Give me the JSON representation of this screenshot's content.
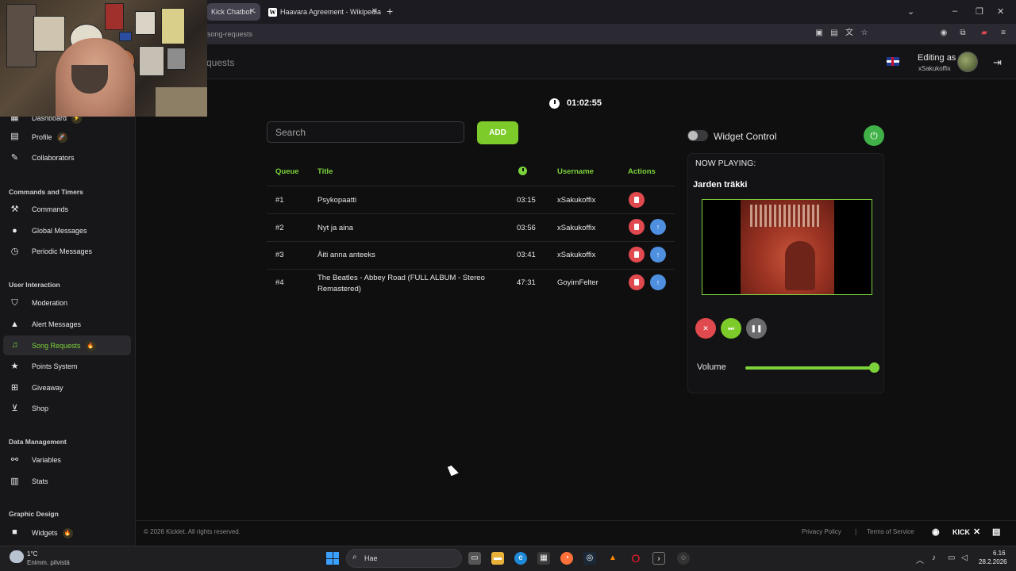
{
  "browser": {
    "tabs": [
      {
        "label": "Kick Chatbot -"
      },
      {
        "label": "Haavara Agreement - Wikipedia"
      }
    ],
    "url_path": "song-requests"
  },
  "header": {
    "page_title": "quests",
    "editing_as": "Editing as",
    "username": "xSakukoffix"
  },
  "sidebar": {
    "items": [
      {
        "label": "Dashboard",
        "icon": "grid-icon",
        "badge": "⚡"
      },
      {
        "label": "Profile",
        "icon": "list-icon",
        "badge": "🚀"
      },
      {
        "label": "Collaborators",
        "icon": "tools-icon"
      },
      {
        "label": "Commands",
        "icon": "hammer-icon"
      },
      {
        "label": "Global Messages",
        "icon": "chat-icon"
      },
      {
        "label": "Periodic Messages",
        "icon": "clock-icon"
      },
      {
        "label": "Moderation",
        "icon": "shield-icon"
      },
      {
        "label": "Alert Messages",
        "icon": "warning-icon"
      },
      {
        "label": "Song Requests",
        "icon": "music-icon",
        "badge": "🔥",
        "active": true
      },
      {
        "label": "Points System",
        "icon": "star-icon"
      },
      {
        "label": "Giveaway",
        "icon": "gift-icon"
      },
      {
        "label": "Shop",
        "icon": "cart-icon"
      },
      {
        "label": "Variables",
        "icon": "link-icon"
      },
      {
        "label": "Stats",
        "icon": "bar-chart-icon"
      },
      {
        "label": "Widgets",
        "icon": "video-icon",
        "badge": "🔥"
      }
    ],
    "sections": [
      "Commands and Timers",
      "User Interaction",
      "Data Management",
      "Graphic Design"
    ]
  },
  "timer": "01:02:55",
  "search": {
    "placeholder": "Search"
  },
  "add_label": "ADD",
  "table": {
    "headers": {
      "queue": "Queue",
      "title": "Title",
      "username": "Username",
      "actions": "Actions"
    },
    "rows": [
      {
        "queue": "#1",
        "title": "Psykopaatti",
        "duration": "03:15",
        "username": "xSakukoffix"
      },
      {
        "queue": "#2",
        "title": "Nyt ja aina",
        "duration": "03:56",
        "username": "xSakukoffix"
      },
      {
        "queue": "#3",
        "title": "Äiti anna anteeks",
        "duration": "03:41",
        "username": "xSakukoffix"
      },
      {
        "queue": "#4",
        "title": "The Beatles - Abbey Road (FULL ALBUM - Stereo Remastered)",
        "duration": "47:31",
        "username": "GoyimFelter"
      }
    ]
  },
  "player": {
    "widget_control": "Widget Control",
    "now_playing_label": "NOW PLAYING:",
    "now_playing_title": "Jarden träkki",
    "volume_label": "Volume",
    "volume": 1.0,
    "colors": {
      "accent": "#7bd23a",
      "delete": "#e0494d",
      "move_up": "#4e8fe0"
    }
  },
  "footer": {
    "copyright": "© 2026 Kicklet. All rights reserved.",
    "privacy": "Privacy Policy",
    "separator": "|",
    "terms": "Terms of Service",
    "kick_logo": "KICK"
  },
  "taskbar": {
    "weather_temp": "1°C",
    "weather_desc": "Enimm. pilvistä",
    "search_text": "Hae",
    "time": "6.16",
    "date": "28.2.2026"
  }
}
